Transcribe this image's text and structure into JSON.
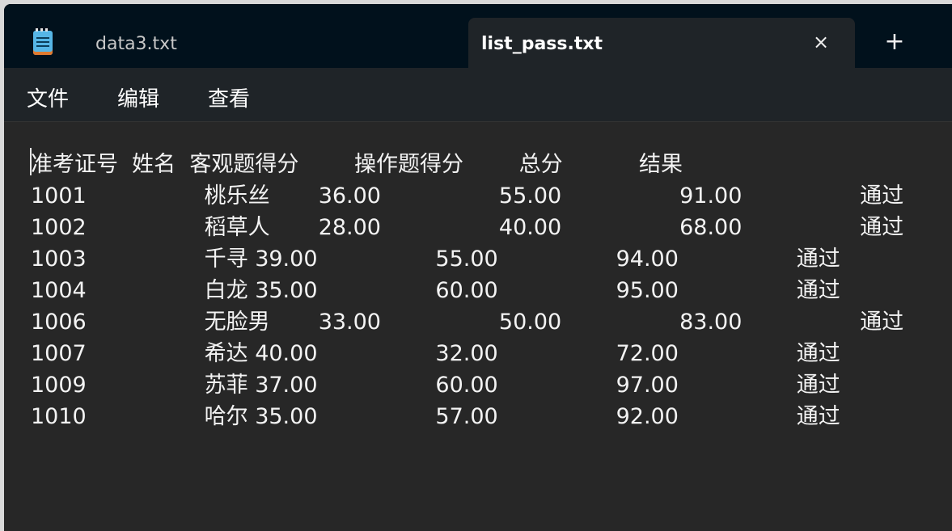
{
  "tabs": [
    {
      "label": "data3.txt",
      "active": false
    },
    {
      "label": "list_pass.txt",
      "active": true
    }
  ],
  "tab_close_glyph": "×",
  "new_tab_glyph": "+",
  "menu": {
    "file": "文件",
    "edit": "编辑",
    "view": "查看"
  },
  "document": {
    "lines": [
      "准考证号  姓名  客观题得分        操作题得分        总分           结果",
      "1001                 桃乐丝       36.00                 55.00                 91.00                 通过",
      "1002                 稻草人       28.00                 40.00                 68.00                 通过",
      "1003                 千寻 39.00                 55.00                 94.00                 通过",
      "1004                 白龙 35.00                 60.00                 95.00                 通过",
      "1006                 无脸男       33.00                 50.00                 83.00                 通过",
      "1007                 希达 40.00                 32.00                 72.00                 通过",
      "1009                 苏菲 37.00                 60.00                 97.00                 通过",
      "1010                 哈尔 35.00                 57.00                 92.00                 通过"
    ]
  },
  "colors": {
    "titlebar": "#01111c",
    "active_tab": "#1f2428",
    "editor_bg": "#272727",
    "text": "#f3f3f3"
  },
  "icons": {
    "app": "notepad-icon",
    "close": "close-icon",
    "add": "plus-icon"
  }
}
